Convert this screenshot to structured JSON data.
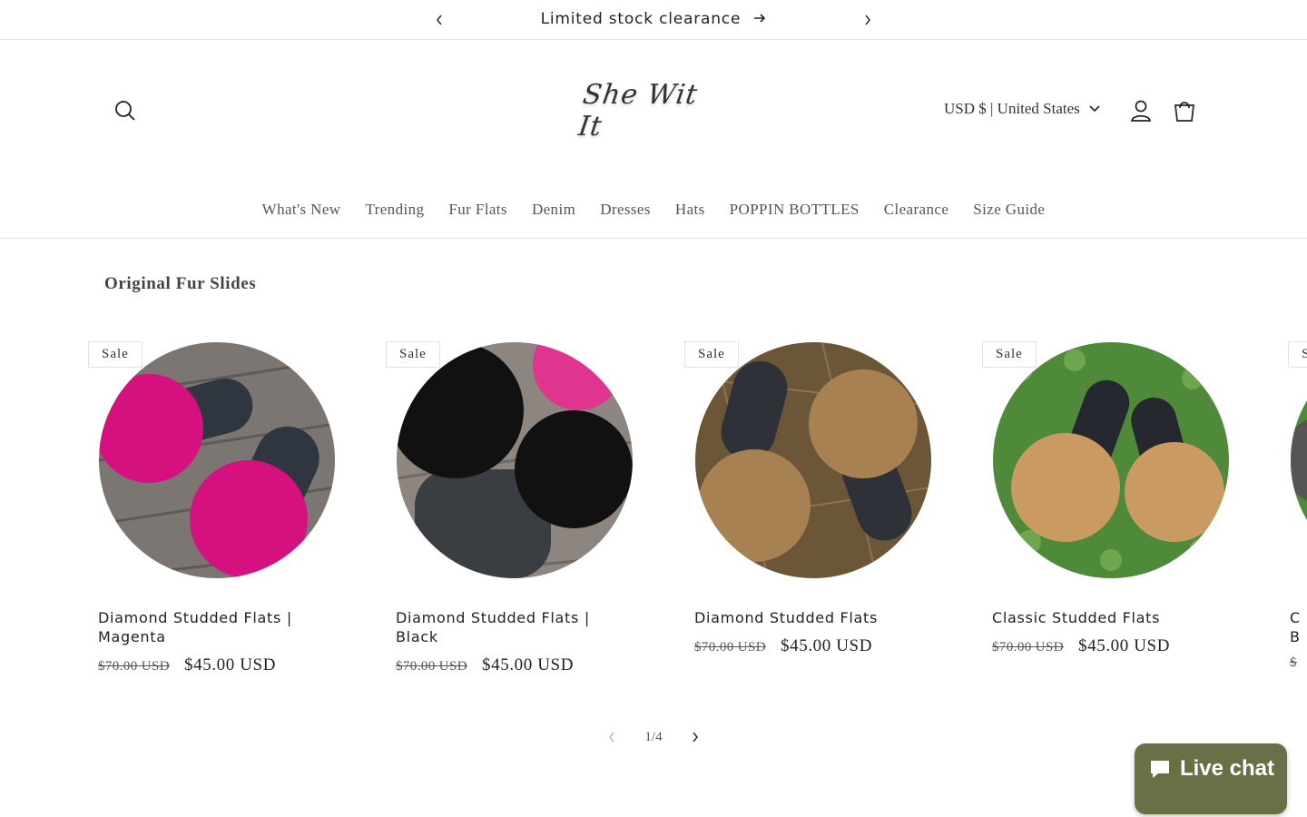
{
  "announcement": {
    "text": "Limited stock clearance"
  },
  "header": {
    "logo_text": "She Wit It",
    "currency": "USD $ | United States"
  },
  "nav": [
    "What's New",
    "Trending",
    "Fur Flats",
    "Denim",
    "Dresses",
    "Hats",
    "POPPIN BOTTLES",
    "Clearance",
    "Size Guide"
  ],
  "section": {
    "title": "Original Fur Slides"
  },
  "products": [
    {
      "badge": "Sale",
      "title": "Diamond Studded Flats | Magenta",
      "old_price": "$70.00 USD",
      "new_price": "$45.00 USD",
      "fur_color": "#d4117f"
    },
    {
      "badge": "Sale",
      "title": "Diamond Studded Flats | Black",
      "old_price": "$70.00 USD",
      "new_price": "$45.00 USD",
      "fur_color": "#111111"
    },
    {
      "badge": "Sale",
      "title": "Diamond Studded Flats",
      "old_price": "$70.00 USD",
      "new_price": "$45.00 USD",
      "fur_color": "#a88152"
    },
    {
      "badge": "Sale",
      "title": "Classic Studded Flats",
      "old_price": "$70.00 USD",
      "new_price": "$45.00 USD",
      "fur_color": "#c99a62"
    },
    {
      "badge": "S",
      "title": "C B",
      "old_price": "$",
      "new_price": "",
      "fur_color": "#888888"
    }
  ],
  "pager": {
    "current": "1",
    "total": "4",
    "label": "1/4"
  },
  "chat": {
    "label": "Live chat",
    "color": "#6b6f45"
  }
}
